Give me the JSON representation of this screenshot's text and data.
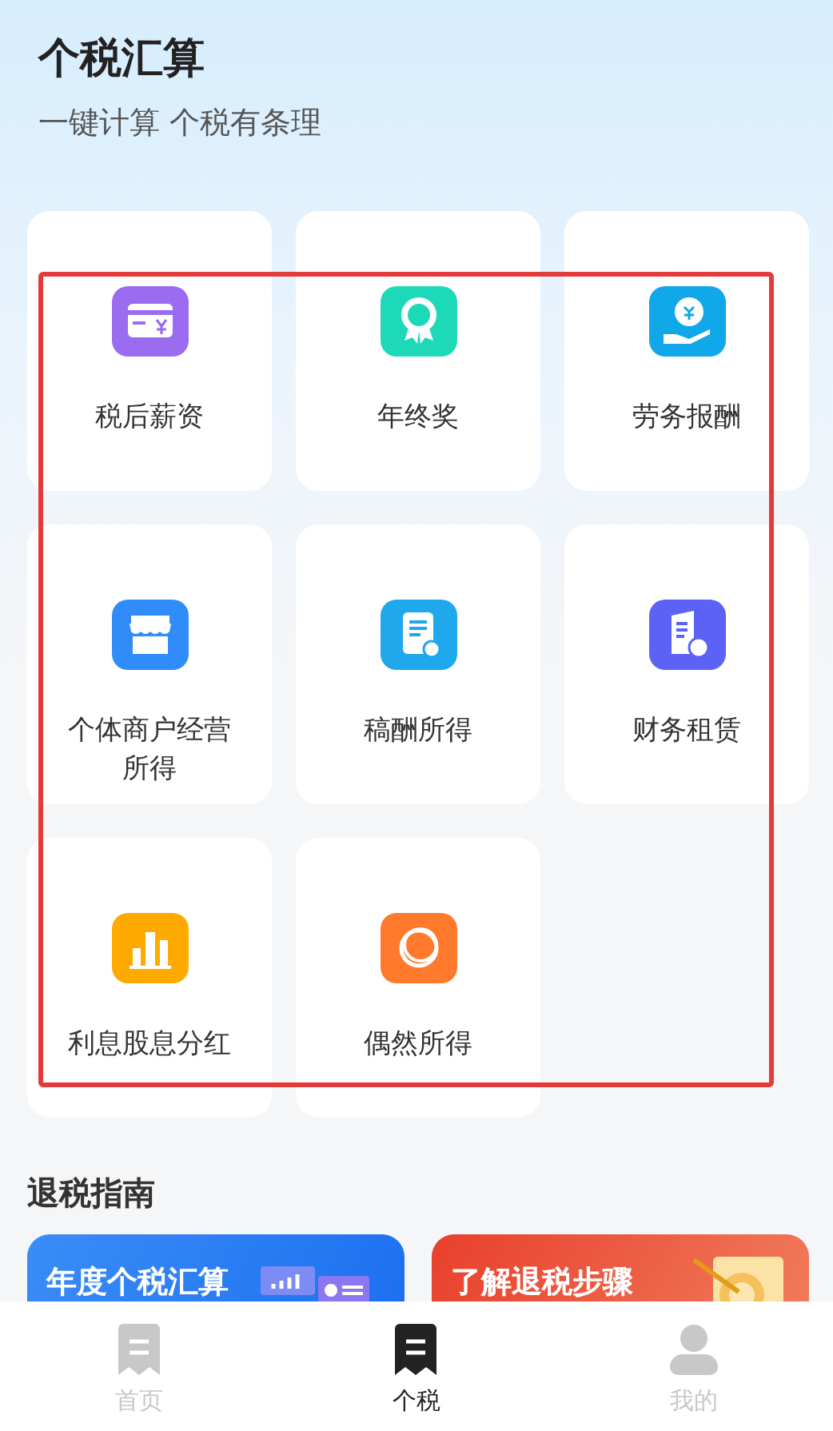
{
  "header": {
    "title": "个税汇算",
    "subtitle": "一键计算 个税有条理"
  },
  "calculators": [
    {
      "label": "税后薪资",
      "kind": "card",
      "color": "#9b6bf0"
    },
    {
      "label": "年终奖",
      "kind": "award",
      "color": "#1ed9b8"
    },
    {
      "label": "劳务报酬",
      "kind": "coin-hand",
      "color": "#10a8e8"
    },
    {
      "label": "个体商户经营所得",
      "kind": "shop",
      "color": "#2f8cf8"
    },
    {
      "label": "稿酬所得",
      "kind": "document",
      "color": "#1fa8ec"
    },
    {
      "label": "财务租赁",
      "kind": "building",
      "color": "#5b62f5"
    },
    {
      "label": "利息股息分红",
      "kind": "bars",
      "color": "#ffaa00"
    },
    {
      "label": "偶然所得",
      "kind": "rings",
      "color": "#ff7a2d"
    }
  ],
  "guide": {
    "title": "退税指南",
    "banners": [
      {
        "text": "年度个税汇算",
        "kind": "chart"
      },
      {
        "text": "了解退税步骤",
        "kind": "target"
      }
    ]
  },
  "tab_bar": [
    {
      "label": "首页",
      "kind": "receipt",
      "selected": false
    },
    {
      "label": "个税",
      "kind": "receipt",
      "selected": true
    },
    {
      "label": "我的",
      "kind": "person",
      "selected": false
    }
  ]
}
